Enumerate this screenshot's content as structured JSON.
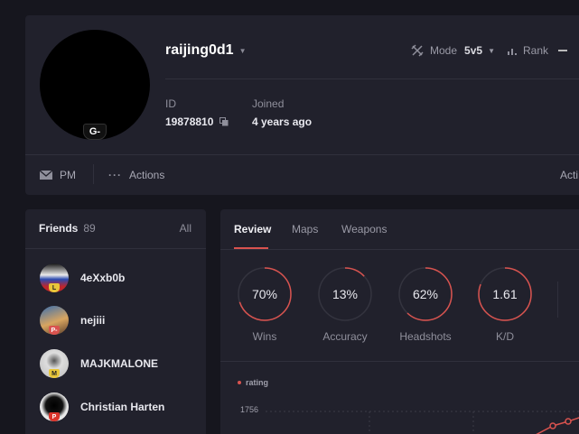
{
  "profile": {
    "username": "raijing0d1",
    "level_badge": "G-",
    "mode_label": "Mode",
    "mode_value": "5v5",
    "rank_label": "Rank",
    "id_label": "ID",
    "id_value": "19878810",
    "joined_label": "Joined",
    "joined_value": "4 years ago",
    "pm_label": "PM",
    "actions_label": "Actions",
    "actions_right": "Acti"
  },
  "friends": {
    "title": "Friends",
    "count": "89",
    "all_label": "All",
    "items": [
      {
        "name": "4eXxb0b",
        "level": "L"
      },
      {
        "name": "nejiii",
        "level": "P-"
      },
      {
        "name": "MAJKMALONE",
        "level": "M"
      },
      {
        "name": "Christian Harten",
        "level": "P"
      }
    ]
  },
  "stats": {
    "tabs": [
      "Review",
      "Maps",
      "Weapons"
    ],
    "metrics": [
      {
        "value": "70%",
        "label": "Wins",
        "fill": 0.7
      },
      {
        "value": "13%",
        "label": "Accuracy",
        "fill": 0.13
      },
      {
        "value": "62%",
        "label": "Headshots",
        "fill": 0.62
      },
      {
        "value": "1.61",
        "label": "K/D",
        "fill": 0.81
      }
    ],
    "rating_label": "rating",
    "rating_tick": "1756"
  },
  "colors": {
    "accent": "#d9534f",
    "panel": "#21212c",
    "background": "#16161e"
  }
}
